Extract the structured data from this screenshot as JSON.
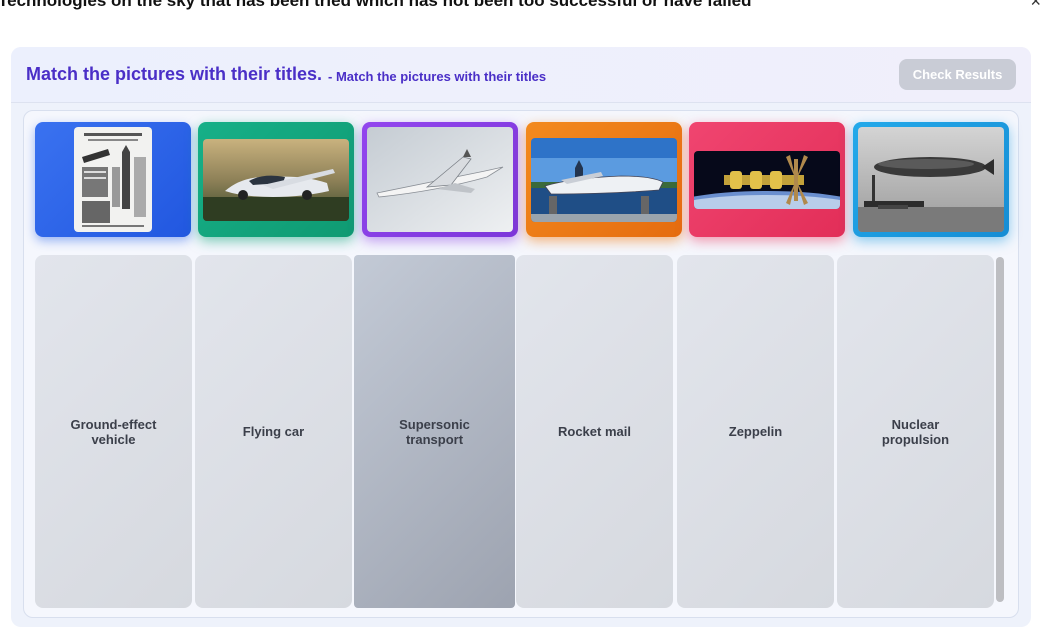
{
  "page": {
    "title": "Technologies on the sky that has been tried which has not been too successful or have failed",
    "close_symbol": "×"
  },
  "panel": {
    "title": "Match the pictures with their titles.",
    "subtitle": "- Match the pictures with their titles",
    "check_button": "Check Results"
  },
  "pictures": [
    {
      "depicts": "rocket-mail-document",
      "frame_color": "#2b63e8"
    },
    {
      "depicts": "flying-car",
      "frame_color": "#13a47c"
    },
    {
      "depicts": "supersonic-transport",
      "frame_color": "#8b3fe6"
    },
    {
      "depicts": "ground-effect-vehicle",
      "frame_color": "#ef7a16"
    },
    {
      "depicts": "nuclear-propulsion",
      "frame_color": "#ec3a62"
    },
    {
      "depicts": "zeppelin",
      "frame_color": "#1e9be0"
    }
  ],
  "titles": [
    "Ground-effect vehicle",
    "Flying car",
    "Supersonic transport",
    "Rocket mail",
    "Zeppelin",
    "Nuclear propulsion"
  ]
}
